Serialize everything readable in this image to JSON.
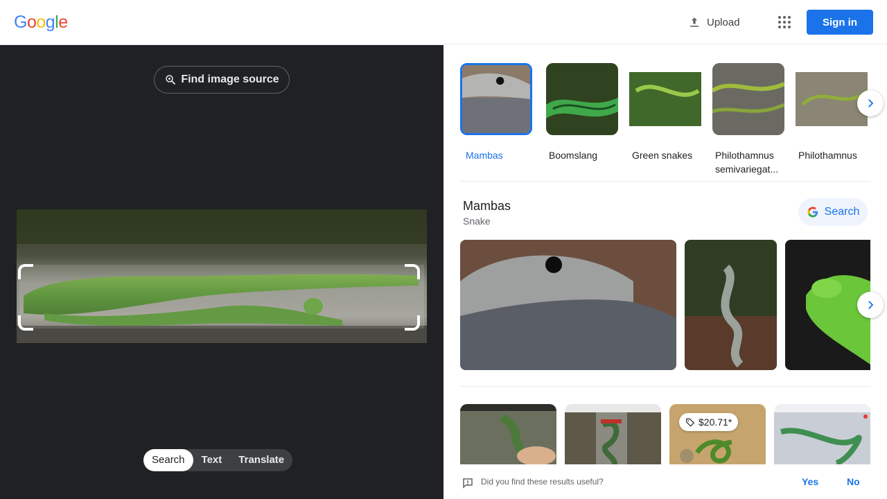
{
  "header": {
    "logo_letters": [
      "G",
      "o",
      "o",
      "g",
      "l",
      "e"
    ],
    "logo_colors": [
      "#4285f4",
      "#ea4335",
      "#fbbc05",
      "#4285f4",
      "#34a853",
      "#ea4335"
    ],
    "upload_label": "Upload",
    "apps_icon": "apps-grid-icon",
    "signin_label": "Sign in"
  },
  "lens": {
    "find_source_label": "Find image source",
    "modes": [
      {
        "label": "Search",
        "active": true
      },
      {
        "label": "Text",
        "active": false
      },
      {
        "label": "Translate",
        "active": false
      }
    ]
  },
  "chips": [
    {
      "label": "Mambas",
      "selected": true
    },
    {
      "label": "Boomslang",
      "selected": false
    },
    {
      "label": "Green snakes",
      "selected": false
    },
    {
      "label": "Philothamnus semivariegat...",
      "selected": false
    },
    {
      "label": "Philothamnus",
      "selected": false
    }
  ],
  "knowledge": {
    "title": "Mambas",
    "subtitle": "Snake",
    "search_label": "Search"
  },
  "results": {
    "price_tag": "$20.71*"
  },
  "feedback": {
    "question": "Did you find these results useful?",
    "yes": "Yes",
    "no": "No"
  },
  "colors": {
    "accent": "#1a73e8",
    "dark_pane": "#202124"
  }
}
